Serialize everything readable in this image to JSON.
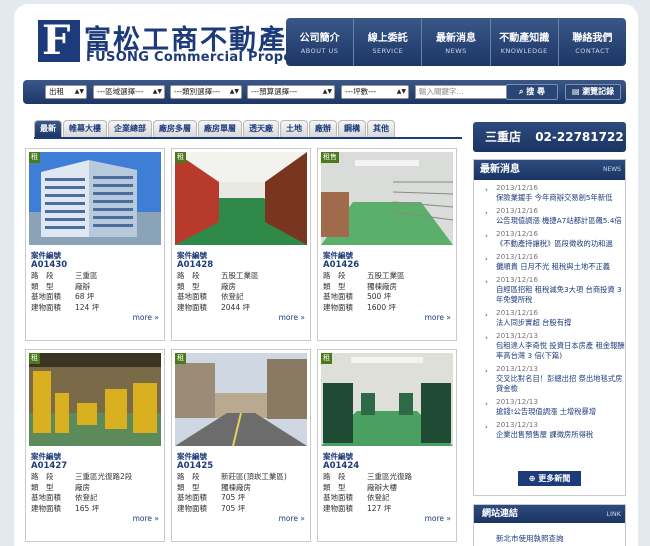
{
  "logo": {
    "mark": "F",
    "zh": "富松工商不動產",
    "en": "FUSONG Commercial Properties"
  },
  "nav": [
    {
      "zh": "公司簡介",
      "en": "ABOUT US"
    },
    {
      "zh": "線上委託",
      "en": "SERVICE"
    },
    {
      "zh": "最新消息",
      "en": "NEWS"
    },
    {
      "zh": "不動產知識",
      "en": "KNOWLEDGE"
    },
    {
      "zh": "聯絡我們",
      "en": "CONTACT"
    }
  ],
  "search": {
    "type": "出租",
    "district": "---區域選擇---",
    "category": "---類別選擇---",
    "budget": "---預算選擇---",
    "size": "---坪數---",
    "keyword_placeholder": "輸入關鍵字...",
    "search_label": "搜 尋",
    "history_label": "瀏覽記錄"
  },
  "tabs": [
    "最新",
    "帷幕大樓",
    "企業總部",
    "廠房多層",
    "廠房單層",
    "透天廠",
    "土地",
    "廠辦",
    "鋼構",
    "其他"
  ],
  "labels": {
    "case_no": "案件編號",
    "road": "路　段",
    "type": "類　型",
    "land": "基地面積",
    "building": "建物面積",
    "more": "more »"
  },
  "listings": [
    {
      "badge": "租",
      "code": "A01430",
      "road": "三重區",
      "type": "廠辦",
      "land": "68 坪",
      "building": "124 坪"
    },
    {
      "badge": "租",
      "code": "A01428",
      "road": "五股工業區",
      "type": "廠房",
      "land": "依登記",
      "building": "2044 坪"
    },
    {
      "badge": "租售",
      "code": "A01426",
      "road": "五股工業區",
      "type": "獨棟廠房",
      "land": "500 坪",
      "building": "1600 坪"
    },
    {
      "badge": "租",
      "code": "A01427",
      "road": "三重區光復路2段",
      "type": "廠房",
      "land": "依登記",
      "building": "165 坪"
    },
    {
      "badge": "租",
      "code": "A01425",
      "road": "新莊區(頂崁工業區)",
      "type": "獨棟廠房",
      "land": "705 坪",
      "building": "705 坪"
    },
    {
      "badge": "租",
      "code": "A01424",
      "road": "三重區光復路",
      "type": "廠辦大樓",
      "land": "依登記",
      "building": "127 坪"
    }
  ],
  "branch": {
    "name": "三重店",
    "phone": "02-22781722"
  },
  "news": {
    "title": "最新消息",
    "title_en": "NEWS",
    "items": [
      {
        "date": "2013/12/16",
        "title": "保險業鍍手 今年商辦交易創5年新低"
      },
      {
        "date": "2013/12/16",
        "title": "公告現值調漲 機捷A7站都計區飆5.4倍"
      },
      {
        "date": "2013/12/16",
        "title": "《不動產持讓稅》區段徵收的功和過"
      },
      {
        "date": "2013/12/16",
        "title": "攤順貴 日月不光 租稅與土地不正義"
      },
      {
        "date": "2013/12/16",
        "title": "自經區招租 租稅減免3大項 台商投資 3年免雙所稅"
      },
      {
        "date": "2013/12/16",
        "title": "法人同步實超 台股有撐"
      },
      {
        "date": "2013/12/13",
        "title": "包租達人李奇悅 投資日本房產 租金報酬率高台灣 3 倍(下篇)"
      },
      {
        "date": "2013/12/13",
        "title": "交叉比對名目！彭總出招 祭出地毯式房貸金檢"
      },
      {
        "date": "2013/12/13",
        "title": "搶錢!公告現值調漲 土增稅暴增"
      },
      {
        "date": "2013/12/13",
        "title": "企業出售預售屋 課徵房所得稅"
      }
    ],
    "more": "更多新聞"
  },
  "links": {
    "title": "網站連結",
    "title_en": "LINK",
    "items": [
      "新北市使用執照查詢"
    ]
  }
}
